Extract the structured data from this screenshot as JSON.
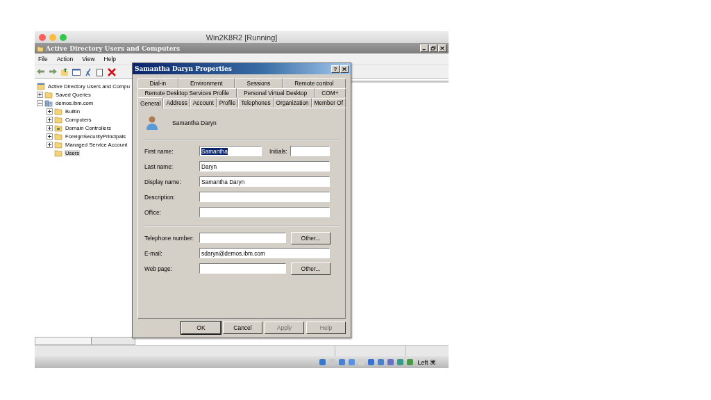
{
  "host_window": {
    "title": "Win2K8R2 [Running]"
  },
  "window": {
    "title": "Active Directory Users and Computers"
  },
  "menu": [
    "File",
    "Action",
    "View",
    "Help"
  ],
  "tree": [
    {
      "label": "Active Directory Users and Compu",
      "kind": "console",
      "selected": false,
      "children": [
        {
          "label": "Saved Queries",
          "kind": "folder",
          "expanded": false,
          "selected": false
        },
        {
          "label": "demos.ibm.com",
          "kind": "domain",
          "expanded": true,
          "selected": false,
          "children": [
            {
              "label": "Builtin",
              "kind": "folder",
              "expanded": false,
              "selected": false
            },
            {
              "label": "Computers",
              "kind": "folder",
              "expanded": false,
              "selected": false
            },
            {
              "label": "Domain Controllers",
              "kind": "ou",
              "expanded": false,
              "selected": false
            },
            {
              "label": "ForeignSecurityPrincipals",
              "kind": "folder",
              "expanded": false,
              "selected": false
            },
            {
              "label": "Managed Service Account",
              "kind": "folder",
              "expanded": false,
              "selected": false
            },
            {
              "label": "Users",
              "kind": "folder",
              "selected": true
            }
          ]
        }
      ]
    }
  ],
  "dialog": {
    "title": "Samantha Daryn Properties",
    "help": "?",
    "tab_rows": [
      [
        {
          "label": "Dial-in",
          "selected": false
        },
        {
          "label": "Environment",
          "selected": false
        },
        {
          "label": "Sessions",
          "selected": false
        },
        {
          "label": "Remote control",
          "selected": false
        }
      ],
      [
        {
          "label": "Remote Desktop Services Profile",
          "selected": false
        },
        {
          "label": "Personal Virtual Desktop",
          "selected": false
        },
        {
          "label": "COM+",
          "selected": false
        }
      ],
      [
        {
          "label": "General",
          "selected": true
        },
        {
          "label": "Address",
          "selected": false
        },
        {
          "label": "Account",
          "selected": false
        },
        {
          "label": "Profile",
          "selected": false
        },
        {
          "label": "Telephones",
          "selected": false
        },
        {
          "label": "Organization",
          "selected": false
        },
        {
          "label": "Member Of",
          "selected": false
        }
      ]
    ],
    "user_name": "Samantha Daryn",
    "field_groups": [
      [
        {
          "kind": "with-initials",
          "label": "First name:",
          "value": "Samantha",
          "text_selected": true,
          "initials_label": "Initials:"
        },
        {
          "kind": "plain",
          "label": "Last name:",
          "value": "Daryn",
          "text_selected": false
        },
        {
          "kind": "plain",
          "label": "Display name:",
          "value": "Samantha Daryn",
          "text_selected": false
        },
        {
          "kind": "plain",
          "label": "Description:"
        },
        {
          "kind": "plain",
          "label": "Office:"
        }
      ],
      [
        {
          "kind": "with-button",
          "label": "Telephone number:",
          "button": "Other..."
        },
        {
          "kind": "plain",
          "label": "E-mail:",
          "value": "sdaryn@demos.ibm.com",
          "text_selected": false
        },
        {
          "kind": "with-button",
          "label": "Web page:",
          "button": "Other..."
        }
      ]
    ],
    "buttons": [
      {
        "label": "OK",
        "default": true,
        "disabled": false
      },
      {
        "label": "Cancel",
        "default": false,
        "disabled": false
      },
      {
        "label": "Apply",
        "default": false,
        "disabled": true
      },
      {
        "label": "Help",
        "default": false,
        "disabled": true
      }
    ]
  },
  "host_status": {
    "key_label": "Left ⌘"
  }
}
